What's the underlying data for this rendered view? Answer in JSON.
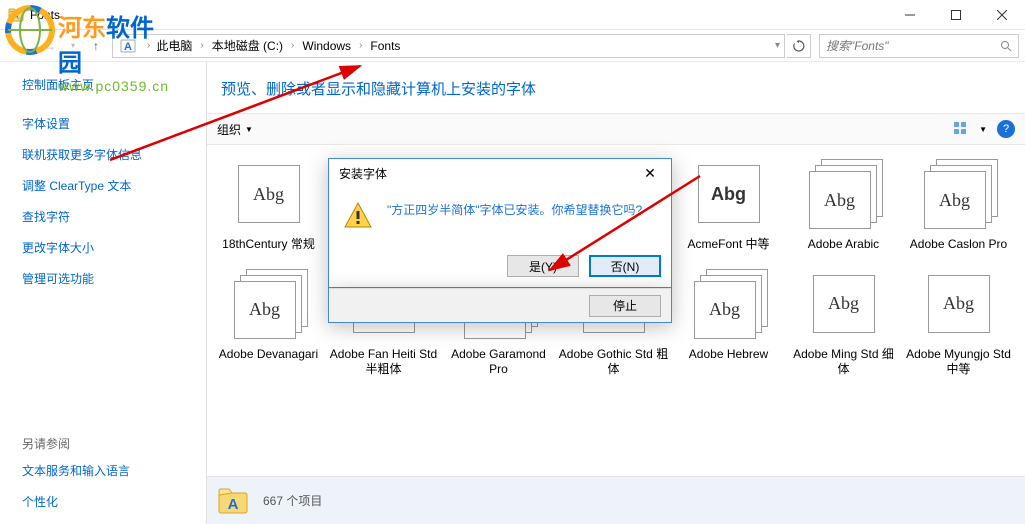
{
  "titlebar": {
    "title": "Fonts"
  },
  "nav": {
    "crumbs": [
      "此电脑",
      "本地磁盘 (C:)",
      "Windows",
      "Fonts"
    ],
    "search_placeholder": "搜索\"Fonts\""
  },
  "sidebar": {
    "home": "控制面板主页",
    "links": [
      "字体设置",
      "联机获取更多字体信息",
      "调整 ClearType 文本",
      "查找字符",
      "更改字体大小",
      "管理可选功能"
    ],
    "see_also_header": "另请参阅",
    "see_also": [
      "文本服务和输入语言",
      "个性化"
    ]
  },
  "page": {
    "title": "预览、删除或者显示和隐藏计算机上安装的字体",
    "organize": "组织"
  },
  "fonts_row1": [
    {
      "name": "18thCentury 常规",
      "sample": "Abg",
      "stack": false,
      "family": "serif"
    },
    {
      "name": "",
      "sample": "",
      "stack": false
    },
    {
      "name": "",
      "sample": "",
      "stack": false
    },
    {
      "name": "",
      "sample": "",
      "stack": false
    },
    {
      "name": "AcmeFont 中等",
      "sample": "Abg",
      "stack": false,
      "bold": true
    },
    {
      "name": "Adobe Arabic",
      "sample": "Abg",
      "stack": true,
      "family": "serif"
    },
    {
      "name": "Adobe Caslon Pro",
      "sample": "Abg",
      "stack": true,
      "family": "serif"
    }
  ],
  "fonts_row2": [
    {
      "name": "Adobe Devanagari",
      "sample": "Abg",
      "stack": true,
      "family": "serif"
    },
    {
      "name": "Adobe Fan Heiti Std 半粗体",
      "sample": "Abg",
      "stack": false,
      "bold": true
    },
    {
      "name": "Adobe Garamond Pro",
      "sample": "Abg",
      "stack": true,
      "family": "serif"
    },
    {
      "name": "Adobe Gothic Std 粗体",
      "sample": "Abg",
      "stack": false,
      "bold": true
    },
    {
      "name": "Adobe Hebrew",
      "sample": "Abg",
      "stack": true,
      "family": "serif"
    },
    {
      "name": "Adobe Ming Std 细体",
      "sample": "Abg",
      "stack": false,
      "family": "serif"
    },
    {
      "name": "Adobe Myungjo Std 中等",
      "sample": "Abg",
      "stack": false,
      "family": "serif"
    }
  ],
  "status": {
    "count": "667 个项目"
  },
  "dialog": {
    "title": "安装字体",
    "message": "\"方正四岁半简体\"字体已安装。你希望替换它吗?",
    "yes": "是(Y)",
    "no": "否(N)",
    "stop": "停止"
  },
  "watermark": {
    "text": "河东软件园",
    "url": "www.pc0359.cn"
  }
}
